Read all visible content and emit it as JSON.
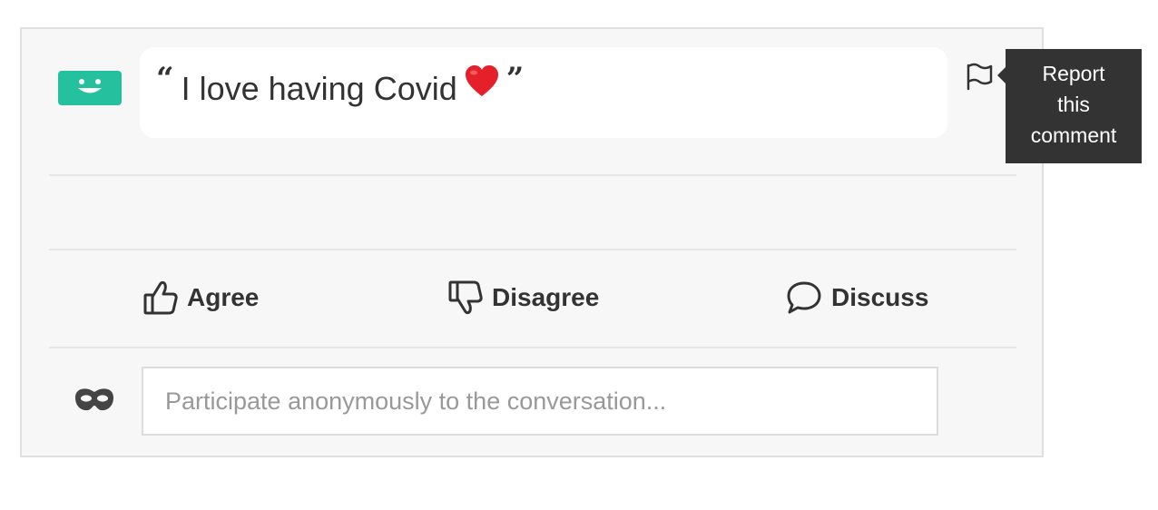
{
  "comment": {
    "text": "I love having Covid",
    "emoji": "heart-emoji"
  },
  "report": {
    "icon": "flag-icon",
    "tooltip_lines": [
      "Report",
      "this",
      "comment"
    ]
  },
  "actions": {
    "agree_label": "Agree",
    "disagree_label": "Disagree",
    "discuss_label": "Discuss"
  },
  "anonymous": {
    "icon": "mask-icon",
    "placeholder": "Participate anonymously to the conversation..."
  },
  "colors": {
    "avatar": "#25c09d",
    "text": "#333333",
    "tooltip_bg": "#333333",
    "card_bg": "#f7f7f7"
  }
}
